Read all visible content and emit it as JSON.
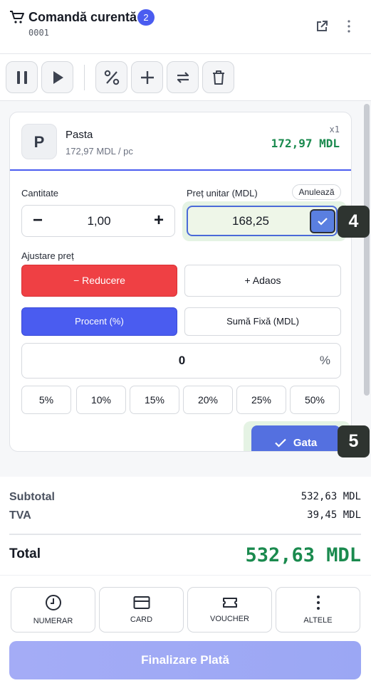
{
  "header": {
    "title": "Comandă curentă",
    "badge_count": "2",
    "order_number": "0001",
    "icons": [
      "cart-icon",
      "open-external-icon",
      "more-vertical-icon"
    ]
  },
  "toolbar": {
    "buttons": [
      "pause-icon",
      "play-icon",
      "percent-icon",
      "plus-icon",
      "swap-icon",
      "trash-icon"
    ]
  },
  "item": {
    "avatar_letter": "P",
    "name": "Pasta",
    "unit_price": "172,97 MDL / pc",
    "quantity_tag": "x1",
    "line_total": "172,97 MDL"
  },
  "editor": {
    "quantity_label": "Cantitate",
    "quantity_value": "1,00",
    "minus": "−",
    "plus": "+",
    "unit_price_label": "Preț unitar (MDL)",
    "cancel_label": "Anulează",
    "unit_price_value": "168,25",
    "adjust_label": "Ajustare preț",
    "discount_label": "− Reducere",
    "markup_label": "+ Adaos",
    "percent_mode_label": "Procent (%)",
    "fixed_mode_label": "Sumă Fixă (MDL)",
    "adjust_value": "0",
    "adjust_unit": "%",
    "quick_percents": [
      "5%",
      "10%",
      "15%",
      "20%",
      "25%",
      "50%"
    ],
    "done_label": "Gata"
  },
  "step_badges": [
    "4",
    "5"
  ],
  "totals": {
    "subtotal_label": "Subtotal",
    "subtotal_value": "532,63 MDL",
    "vat_label": "TVA",
    "vat_value": "39,45 MDL",
    "total_label": "Total",
    "total_value": "532,63 MDL"
  },
  "payment": {
    "methods": [
      {
        "label": "NUMERAR",
        "icon": "cash-clock-icon"
      },
      {
        "label": "CARD",
        "icon": "card-icon"
      },
      {
        "label": "VOUCHER",
        "icon": "voucher-icon"
      },
      {
        "label": "ALTELE",
        "icon": "more-vertical-icon"
      }
    ],
    "finalize_label": "Finalizare Plată"
  },
  "colors": {
    "accent": "#4a5cf0",
    "success": "#1a8a4e",
    "danger": "#ef4044",
    "highlight": "#e5f3e4"
  }
}
